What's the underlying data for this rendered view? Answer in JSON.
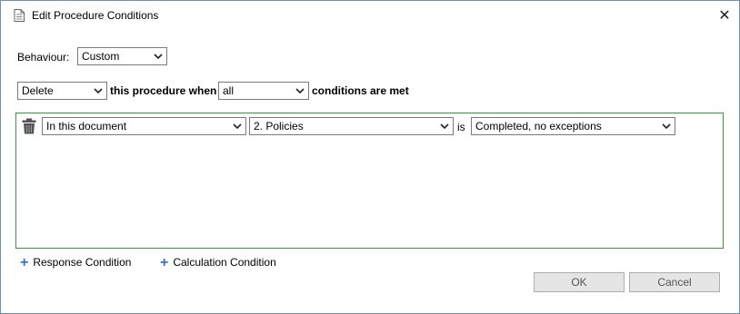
{
  "window": {
    "title": "Edit Procedure Conditions",
    "icon": "document-icon",
    "close_glyph": "✕"
  },
  "behaviour": {
    "label": "Behaviour:",
    "value": "Custom"
  },
  "rule": {
    "action": "Delete",
    "text_middle": "this procedure when",
    "quantifier": "all",
    "text_end": "conditions are met"
  },
  "conditions": [
    {
      "scope": "In this document",
      "target": "2. Policies",
      "operator": "is",
      "value": "Completed, no exceptions"
    }
  ],
  "links": {
    "response_condition": "Response Condition",
    "calculation_condition": "Calculation Condition",
    "plus_glyph": "+"
  },
  "buttons": {
    "ok": "OK",
    "cancel": "Cancel"
  },
  "colors": {
    "condition_border": "#3c9a3c",
    "link_plus": "#3b6fc7",
    "window_border": "#6f8fbf"
  }
}
